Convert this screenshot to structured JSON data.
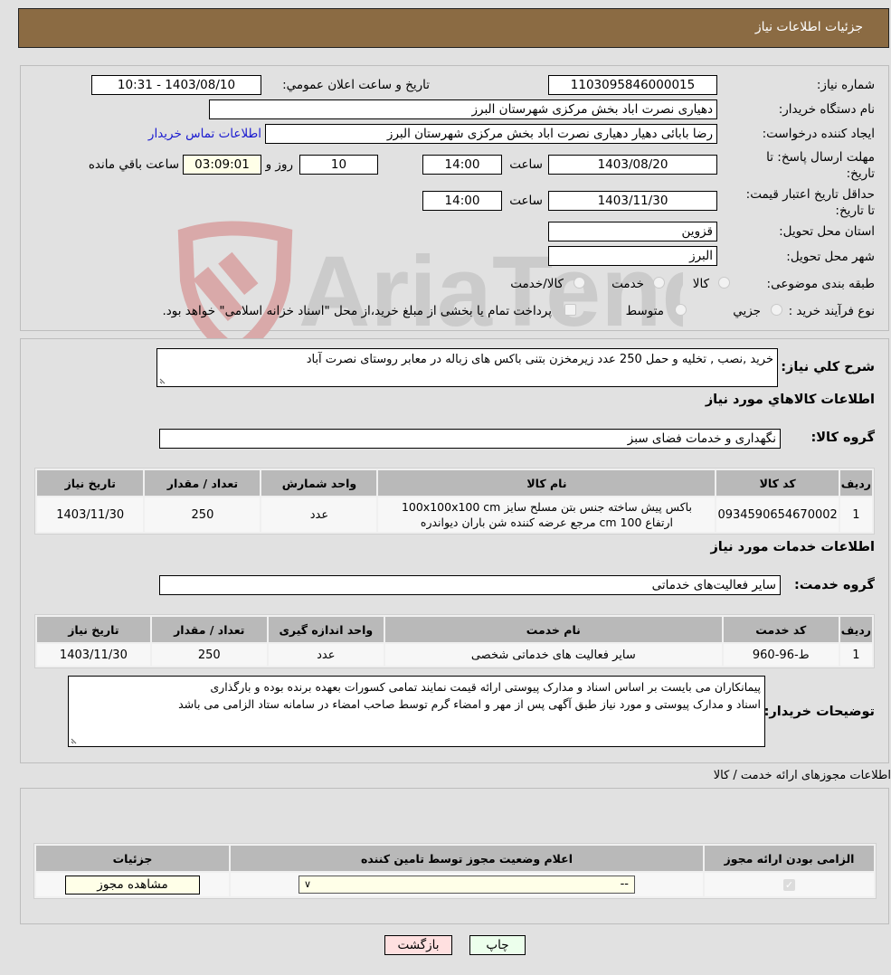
{
  "header": {
    "title": "جزئیات اطلاعات نیاز"
  },
  "fields": {
    "need_number_label": "شماره نیاز:",
    "need_number": "1103095846000015",
    "announce_label": "تاريخ و ساعت اعلان عمومي:",
    "announce_value": "1403/08/10 - 10:31",
    "buyer_org_label": "نام دستگاه خريدار:",
    "buyer_org": "دهیاری نصرت اباد بخش مرکزی شهرستان البرز",
    "creator_label": "ایجاد کننده درخواست:",
    "creator": "رضا بابائی دهیار دهیاری نصرت اباد بخش مرکزی شهرستان البرز",
    "contact_link": "اطلاعات تماس خریدار",
    "reply_deadline_label": "مهلت ارسال پاسخ: تا تاریخ:",
    "reply_date": "1403/08/20",
    "time_label": "ساعت",
    "reply_time": "14:00",
    "days_value": "10",
    "days_label": "روز و",
    "remaining_value": "03:09:01",
    "remaining_label": "ساعت باقي مانده",
    "price_validity_label": "حداقل تاریخ اعتبار قیمت: تا تاریخ:",
    "price_validity_date": "1403/11/30",
    "price_validity_time": "14:00",
    "province_label": "استان محل تحویل:",
    "province": "قزوین",
    "city_label": "شهر محل تحویل:",
    "city": "البرز",
    "category_label": "طبقه بندی موضوعی:",
    "category_options": [
      "کالا",
      "خدمت",
      "کالا/خدمت"
    ],
    "process_label": "نوع فرآیند خرید :",
    "process_options": [
      "جزيي",
      "متوسط"
    ],
    "treasury_note": "پرداخت تمام یا بخشی از مبلغ خرید،از محل \"اسناد خزانه اسلامی\" خواهد بود."
  },
  "description": {
    "label": "شرح کلي نياز:",
    "value": "خرید ,نصب , تخلیه و حمل 250 عدد زیرمخزن بتنی باکس های زباله در معابر روستای نصرت آباد"
  },
  "goods": {
    "section_title": "اطلاعات کالاهاي مورد نياز",
    "group_label": "گروه کالا:",
    "group_value": "نگهداری و خدمات فضای سبز",
    "columns": [
      "رديف",
      "کد کالا",
      "نام کالا",
      "واحد شمارش",
      "تعداد / مقدار",
      "تاريخ نياز"
    ],
    "rows": [
      {
        "row": "1",
        "code": "0934590654670002",
        "name_line1": "باکس پیش ساخته جنس بتن مسلح سایز 100x100x100 cm",
        "name_line2": "ارتفاع 100 cm مرجع عرضه کننده شن باران دیواندره",
        "unit": "عدد",
        "qty": "250",
        "date": "1403/11/30"
      }
    ]
  },
  "services": {
    "section_title": "اطلاعات خدمات مورد نياز",
    "group_label": "گروه خدمت:",
    "group_value": "سایر فعالیت‌های خدماتی",
    "columns": [
      "رديف",
      "کد خدمت",
      "نام خدمت",
      "واحد اندازه گيری",
      "تعداد / مقدار",
      "تاريخ نياز"
    ],
    "rows": [
      {
        "row": "1",
        "code": "ط-96-960",
        "name": "سایر فعالیت های خدماتی شخصی",
        "unit": "عدد",
        "qty": "250",
        "date": "1403/11/30"
      }
    ]
  },
  "buyer_notes": {
    "label": "توضيحات خريدار:",
    "line1": "پیمانکاران می بایست بر اساس اسناد و مدارک پیوستی ارائه قیمت نمایند تمامی کسورات بعهده برنده بوده و بارگذاری",
    "line2": "اسناد و مدارک پیوستی و مورد نیاز طبق آگهی پس از مهر و امضاء گرم توسط صاحب امضاء در سامانه ستاد الزامی می باشد"
  },
  "permits": {
    "section_title": "اطلاعات مجوزهای ارائه خدمت / کالا",
    "columns": [
      "الزامی بودن ارائه مجوز",
      "اعلام وضعیت مجوز توسط تامین کننده",
      "جزئیات"
    ],
    "select_value": "--",
    "view_button": "مشاهده مجوز"
  },
  "footer": {
    "print_label": "چاپ",
    "back_label": "بازگشت"
  },
  "watermark": {
    "text": "AriaTender.neT"
  }
}
